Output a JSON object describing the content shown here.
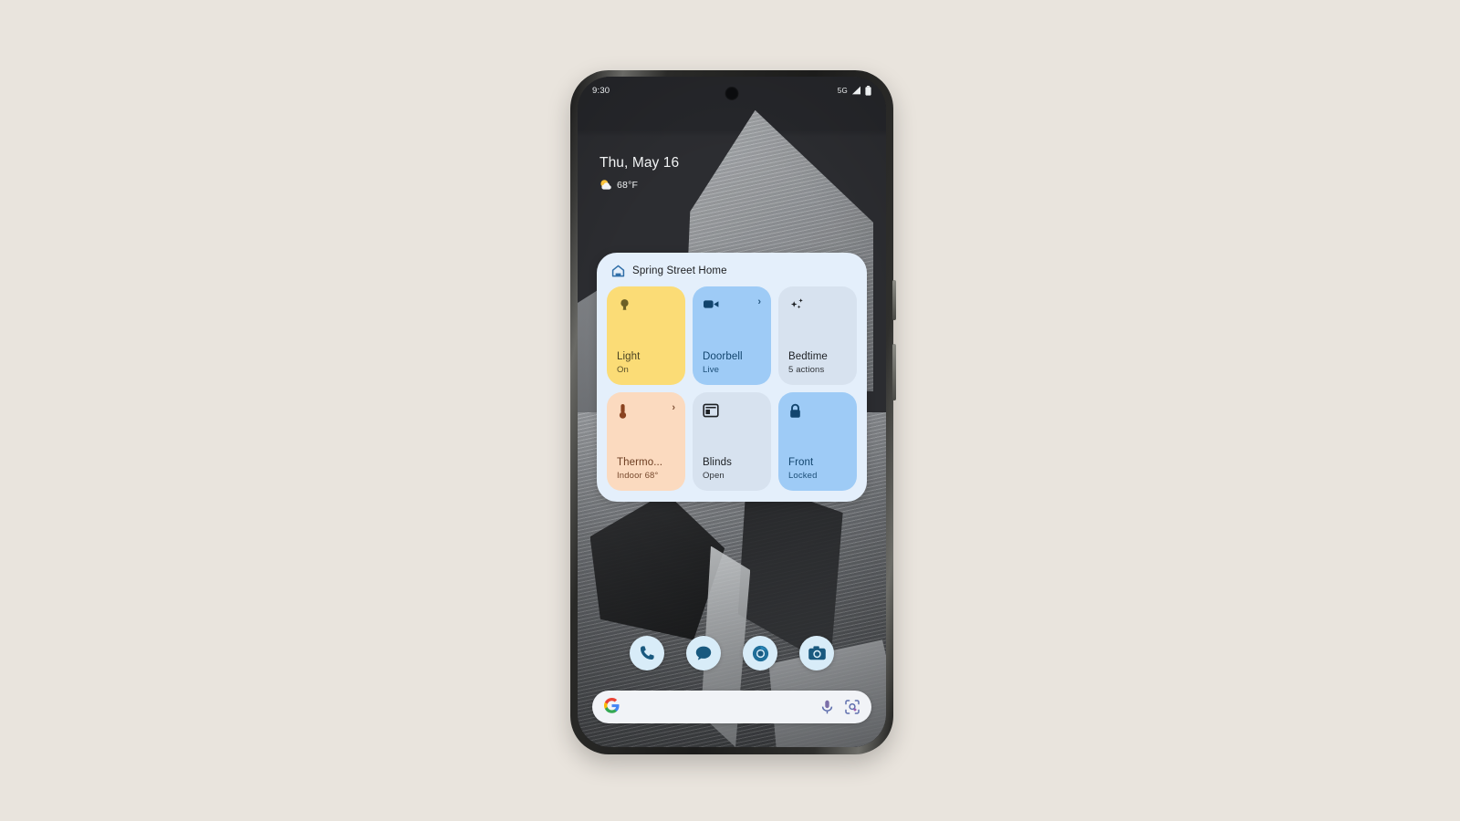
{
  "theme": {
    "page_background": "#e9e4dd",
    "widget_background": "#e4effb",
    "accent_blue": "#12456e",
    "tile_yellow": "#fbdc76",
    "tile_blue": "#9ecbf6",
    "tile_grey": "#d7e2ef",
    "tile_peach": "#fbdabf"
  },
  "status_bar": {
    "time": "9:30",
    "network_label": "5G",
    "signal_icon": "signal-bars-icon",
    "battery_icon": "battery-full-icon",
    "camera_icon": "front-camera-punchhole"
  },
  "clock_widget": {
    "date": "Thu, May 16",
    "weather_icon": "sun-behind-cloud-icon",
    "temperature": "68°F"
  },
  "home_widget": {
    "home_icon": "house-outline-icon",
    "title": "Spring Street Home",
    "tiles": [
      {
        "id": "light",
        "icon": "lightbulb-icon",
        "name": "Light",
        "state": "On",
        "style": "t-yellow",
        "has_chevron": false,
        "chevron": ""
      },
      {
        "id": "doorbell",
        "icon": "video-camera-icon",
        "name": "Doorbell",
        "state": "Live",
        "style": "t-blue",
        "has_chevron": true,
        "chevron": "›"
      },
      {
        "id": "bedtime",
        "icon": "sparkles-routine-icon",
        "name": "Bedtime",
        "state": "5 actions",
        "style": "t-grey",
        "has_chevron": false,
        "chevron": ""
      },
      {
        "id": "thermostat",
        "icon": "thermostat-icon",
        "name": "Thermo...",
        "state": "Indoor 68°",
        "style": "t-peach",
        "has_chevron": true,
        "chevron": "›"
      },
      {
        "id": "blinds",
        "icon": "blinds-icon",
        "name": "Blinds",
        "state": "Open",
        "style": "t-grey",
        "has_chevron": false,
        "chevron": ""
      },
      {
        "id": "front-lock",
        "icon": "padlock-locked-icon",
        "name": "Front",
        "state": "Locked",
        "style": "t-blue",
        "has_chevron": false,
        "chevron": ""
      }
    ]
  },
  "dock": {
    "items": [
      {
        "id": "phone",
        "icon": "phone-icon",
        "label": "Phone"
      },
      {
        "id": "messages",
        "icon": "messages-icon",
        "label": "Messages"
      },
      {
        "id": "chrome",
        "icon": "chrome-icon",
        "label": "Chrome"
      },
      {
        "id": "camera",
        "icon": "camera-icon",
        "label": "Camera"
      }
    ]
  },
  "search_bar": {
    "logo": "G",
    "logo_name": "google-g-logo",
    "placeholder": "",
    "value": "",
    "mic_icon": "microphone-icon",
    "lens_icon": "google-lens-icon"
  }
}
